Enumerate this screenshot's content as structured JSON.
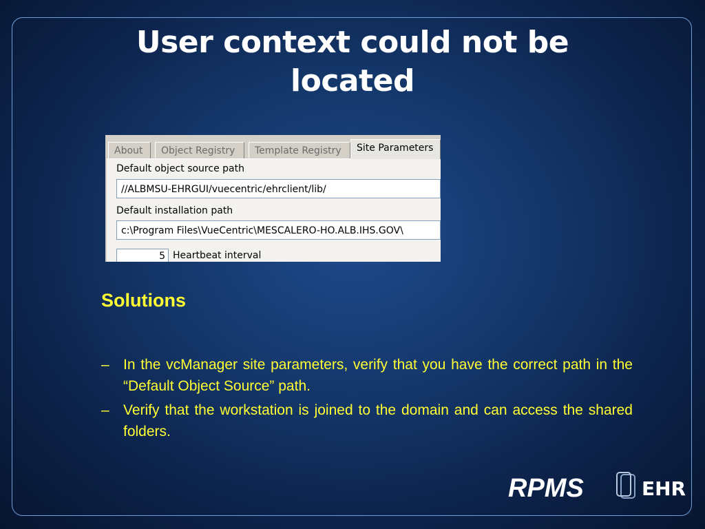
{
  "slide": {
    "title_line1": "User context could not be",
    "title_line2": "located"
  },
  "screenshot": {
    "tabs": [
      "About",
      "Object Registry",
      "Template Registry",
      "Site Parameters"
    ],
    "active_tab": "Site Parameters",
    "object_source_label": "Default object source path",
    "object_source_value": "//ALBMSU-EHRGUI/vuecentric/ehrclient/lib/",
    "install_path_label": "Default installation path",
    "install_path_value": "c:\\Program Files\\VueCentric\\MESCALERO-HO.ALB.IHS.GOV\\",
    "partial_number": "5",
    "partial_label": "Heartbeat interval"
  },
  "solutions": {
    "heading": "Solutions",
    "dash": "–",
    "items": [
      "In the vcManager site parameters, verify that you have the correct path in the “Default Object Source” path.",
      "Verify that the workstation is joined to the domain and can access the shared folders."
    ]
  },
  "logo": {
    "brand": "RPMS",
    "suffix": "EHR"
  },
  "colors": {
    "background": "#143669",
    "title": "#ffffff",
    "accent_text": "#ffff33",
    "frame": "#6f9fd8"
  }
}
